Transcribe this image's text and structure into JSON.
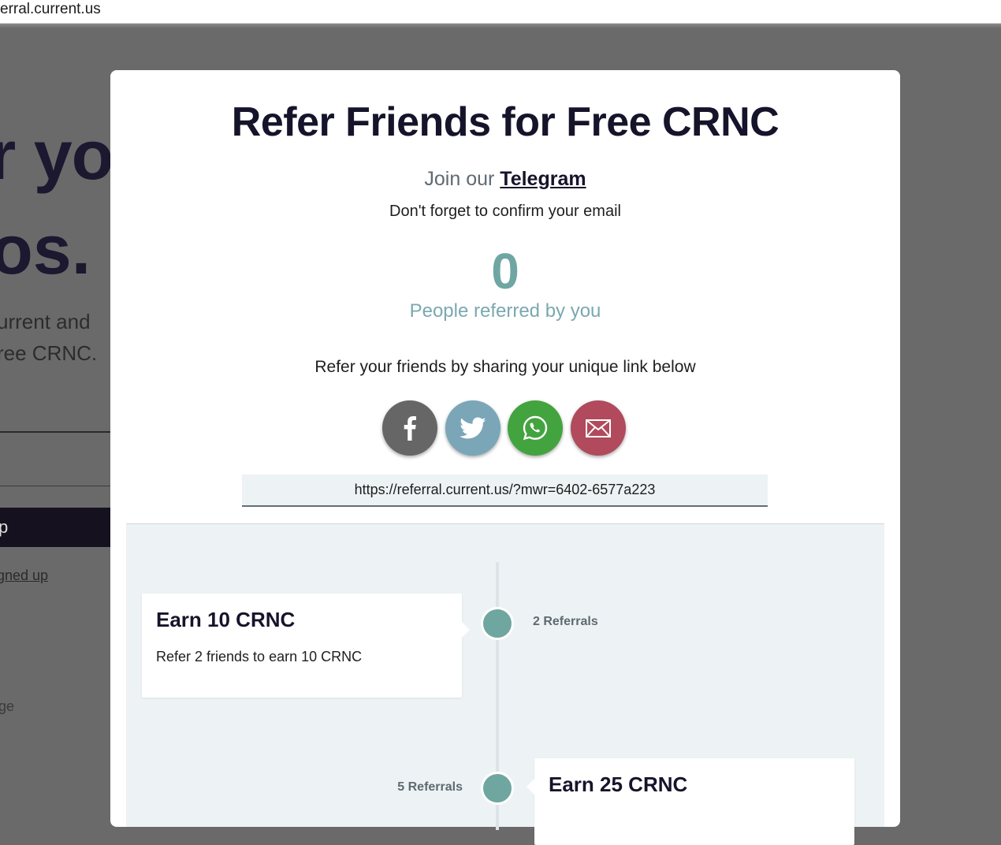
{
  "browser": {
    "url_text": "erral.current.us"
  },
  "background_page": {
    "headline_line1": "r yo",
    "headline_line2": "os.",
    "paragraph_line1": "urrent and",
    "paragraph_line2": "ree CRNC.",
    "button_label": "p",
    "link_text": "gned up",
    "footer_text": "ge"
  },
  "modal": {
    "title": "Refer Friends for Free CRNC",
    "telegram_prefix": "Join our",
    "telegram_link": "Telegram",
    "confirm_email": "Don't forget to confirm your email",
    "referred_count": "0",
    "referred_label": "People referred by you",
    "share_prompt": "Refer your friends by sharing your unique link below",
    "social": [
      {
        "name": "facebook",
        "icon": "facebook-icon",
        "color": "#666666"
      },
      {
        "name": "twitter",
        "icon": "twitter-icon",
        "color": "#7aa6b8"
      },
      {
        "name": "whatsapp",
        "icon": "whatsapp-icon",
        "color": "#43a33f"
      },
      {
        "name": "email",
        "icon": "email-icon",
        "color": "#b04a5c"
      }
    ],
    "referral_link": "https://referral.current.us/?mwr=6402-6577a223"
  },
  "rewards": [
    {
      "title": "Earn 10 CRNC",
      "description": "Refer 2 friends to earn 10 CRNC",
      "referrals": "2 Referrals"
    },
    {
      "title": "Earn 25 CRNC",
      "description": "",
      "referrals": "5 Referrals"
    }
  ],
  "colors": {
    "accent_teal": "#6fa6a3",
    "title_dark": "#16142a",
    "overlay": "#6a6a6a",
    "timeline_bg": "#edf2f4"
  }
}
